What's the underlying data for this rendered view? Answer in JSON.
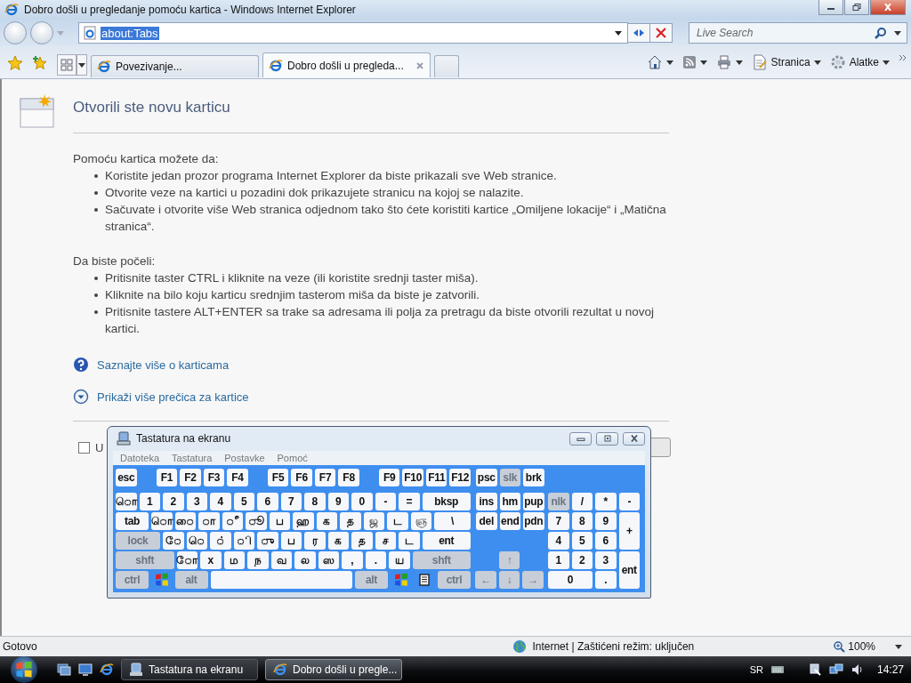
{
  "window": {
    "title": "Dobro došli u pregledanje pomoću kartica - Windows Internet Explorer"
  },
  "address_bar": {
    "value": "about:Tabs"
  },
  "search": {
    "placeholder": "Live Search"
  },
  "tabs": [
    {
      "label": "Povezivanje...",
      "selected": false
    },
    {
      "label": "Dobro došli u pregleda...",
      "selected": true
    }
  ],
  "command_bar": [
    {
      "kind": "home"
    },
    {
      "kind": "feeds"
    },
    {
      "kind": "print"
    },
    {
      "kind": "page",
      "label": "Stranica"
    },
    {
      "kind": "tools",
      "label": "Alatke"
    }
  ],
  "page": {
    "heading": "Otvorili ste novu karticu",
    "sections": [
      {
        "intro": "Pomoću kartica možete da:",
        "items": [
          "Koristite jedan prozor programa Internet Explorer da biste prikazali sve Web stranice.",
          "Otvorite veze na kartici u pozadini dok prikazujete stranicu na kojoj se nalazite.",
          "Sačuvate i otvorite više Web stranica odjednom tako što ćete koristiti kartice „Omiljene lokacije“ i „Matična stranica“."
        ]
      },
      {
        "intro": "Da biste počeli:",
        "items": [
          "Pritisnite taster CTRL i kliknite na veze (ili koristite srednji taster miša).",
          "Kliknite na bilo koju karticu srednjim tasterom miša da biste je zatvorili.",
          "Pritisnite tastere ALT+ENTER sa trake sa adresama ili polja za pretragu da biste otvorili rezultat u novoj kartici."
        ]
      }
    ],
    "links": [
      {
        "kind": "help",
        "label": "Saznajte više o karticama"
      },
      {
        "kind": "expand",
        "label": "Prikaži više prečica za kartice"
      }
    ],
    "checkbox": {
      "label": "U",
      "checked": false
    }
  },
  "keyboard": {
    "title": "Tastatura na ekranu",
    "menu": [
      "Datoteka",
      "Tastatura",
      "Postavke",
      "Pomoć"
    ],
    "function_row": [
      [
        {
          "label": "esc",
          "kind": "key"
        }
      ],
      [
        {
          "label": "F1",
          "kind": "key"
        },
        {
          "label": "F2",
          "kind": "key"
        },
        {
          "label": "F3",
          "kind": "key"
        },
        {
          "label": "F4",
          "kind": "key"
        }
      ],
      [
        {
          "label": "F5",
          "kind": "key"
        },
        {
          "label": "F6",
          "kind": "key"
        },
        {
          "label": "F7",
          "kind": "key"
        },
        {
          "label": "F8",
          "kind": "key"
        }
      ],
      [
        {
          "label": "F9",
          "kind": "key"
        },
        {
          "label": "F10",
          "kind": "key"
        },
        {
          "label": "F11",
          "kind": "key"
        },
        {
          "label": "F12",
          "kind": "key"
        }
      ]
    ],
    "system_keys": [
      {
        "label": "psc",
        "kind": "key"
      },
      {
        "label": "slk",
        "kind": "mod"
      },
      {
        "label": "brk",
        "kind": "key"
      }
    ],
    "main_rows": [
      [
        {
          "label": "ொ",
          "kind": "key"
        },
        {
          "label": "1",
          "kind": "key"
        },
        {
          "label": "2",
          "kind": "key"
        },
        {
          "label": "3",
          "kind": "key"
        },
        {
          "label": "4",
          "kind": "key"
        },
        {
          "label": "5",
          "kind": "key"
        },
        {
          "label": "6",
          "kind": "key"
        },
        {
          "label": "7",
          "kind": "key"
        },
        {
          "label": "8",
          "kind": "key"
        },
        {
          "label": "9",
          "kind": "key"
        },
        {
          "label": "0",
          "kind": "key"
        },
        {
          "label": "-",
          "kind": "key"
        },
        {
          "label": "=",
          "kind": "key"
        },
        {
          "label": "bksp",
          "kind": "grow"
        }
      ],
      [
        {
          "label": "tab",
          "kind": "tab"
        },
        {
          "label": "ொ",
          "kind": "key"
        },
        {
          "label": "ை",
          "kind": "key"
        },
        {
          "label": "ா",
          "kind": "key"
        },
        {
          "label": "ீ",
          "kind": "key"
        },
        {
          "label": "ூ",
          "kind": "key"
        },
        {
          "label": "ப",
          "kind": "key"
        },
        {
          "label": "ஹ",
          "kind": "key"
        },
        {
          "label": "க",
          "kind": "key"
        },
        {
          "label": "த",
          "kind": "key"
        },
        {
          "label": "ஜ",
          "kind": "key"
        },
        {
          "label": "ட",
          "kind": "key"
        },
        {
          "label": "ஞ",
          "kind": "key"
        },
        {
          "label": "\\",
          "kind": "grow"
        }
      ],
      [
        {
          "label": "lock",
          "kind": "lock"
        },
        {
          "label": "ே",
          "kind": "key"
        },
        {
          "label": "ெ",
          "kind": "key"
        },
        {
          "label": "்",
          "kind": "key"
        },
        {
          "label": "ி",
          "kind": "key"
        },
        {
          "label": "ு",
          "kind": "key"
        },
        {
          "label": "ப",
          "kind": "key"
        },
        {
          "label": "ர",
          "kind": "key"
        },
        {
          "label": "க",
          "kind": "key"
        },
        {
          "label": "த",
          "kind": "key"
        },
        {
          "label": "ச",
          "kind": "key"
        },
        {
          "label": "ட",
          "kind": "key"
        },
        {
          "label": "ent",
          "kind": "grow"
        }
      ],
      [
        {
          "label": "shft",
          "kind": "shift"
        },
        {
          "label": "ோ",
          "kind": "key"
        },
        {
          "label": "x",
          "kind": "key"
        },
        {
          "label": "ம",
          "kind": "key"
        },
        {
          "label": "ந",
          "kind": "key"
        },
        {
          "label": "வ",
          "kind": "key"
        },
        {
          "label": "ல",
          "kind": "key"
        },
        {
          "label": "ஸ",
          "kind": "key"
        },
        {
          "label": ",",
          "kind": "key"
        },
        {
          "label": ".",
          "kind": "key"
        },
        {
          "label": "ய",
          "kind": "key"
        },
        {
          "label": "shft",
          "kind": "shift"
        }
      ],
      [
        {
          "label": "ctrl",
          "kind": "ctrl"
        },
        {
          "kind": "win"
        },
        {
          "label": "alt",
          "kind": "ctrl"
        },
        {
          "kind": "space"
        },
        {
          "label": "alt",
          "kind": "ctrl"
        },
        {
          "kind": "win"
        },
        {
          "kind": "menu"
        },
        {
          "label": "ctrl",
          "kind": "ctrl"
        }
      ]
    ],
    "nav_rows": [
      [
        {
          "label": "ins",
          "kind": "key"
        },
        {
          "label": "hm",
          "kind": "key"
        },
        {
          "label": "pup",
          "kind": "key"
        }
      ],
      [
        {
          "label": "del",
          "kind": "key"
        },
        {
          "label": "end",
          "kind": "key"
        },
        {
          "label": "pdn",
          "kind": "key"
        }
      ]
    ],
    "arrow_rows": [
      [
        {
          "label": "↑",
          "kind": "mod"
        }
      ],
      [
        {
          "label": "←",
          "kind": "mod"
        },
        {
          "label": "↓",
          "kind": "mod"
        },
        {
          "label": "→",
          "kind": "mod"
        }
      ]
    ],
    "numpad": [
      {
        "label": "nlk",
        "kind": "mod"
      },
      {
        "label": "/",
        "kind": "key"
      },
      {
        "label": "*",
        "kind": "key"
      },
      {
        "label": "-",
        "kind": "key"
      },
      {
        "label": "7",
        "kind": "key"
      },
      {
        "label": "8",
        "kind": "key"
      },
      {
        "label": "9",
        "kind": "key"
      },
      {
        "label": "+",
        "kind": "tall"
      },
      {
        "label": "4",
        "kind": "key"
      },
      {
        "label": "5",
        "kind": "key"
      },
      {
        "label": "6",
        "kind": "key"
      },
      {
        "label": "1",
        "kind": "key"
      },
      {
        "label": "2",
        "kind": "key"
      },
      {
        "label": "3",
        "kind": "key"
      },
      {
        "label": "ent",
        "kind": "tall"
      },
      {
        "label": "0",
        "kind": "double"
      },
      {
        "label": ".",
        "kind": "key"
      }
    ]
  },
  "status_bar": {
    "text": "Gotovo",
    "zone": "Internet | Zaštićeni režim: uključen",
    "zoom": "100%"
  },
  "taskbar": {
    "tasks": [
      {
        "label": "Tastatura na ekranu",
        "kind": "keyboard",
        "selected": false
      },
      {
        "label": "Dobro došli u pregle...",
        "kind": "browser",
        "selected": true
      }
    ],
    "language": "SR",
    "clock": "14:27"
  }
}
